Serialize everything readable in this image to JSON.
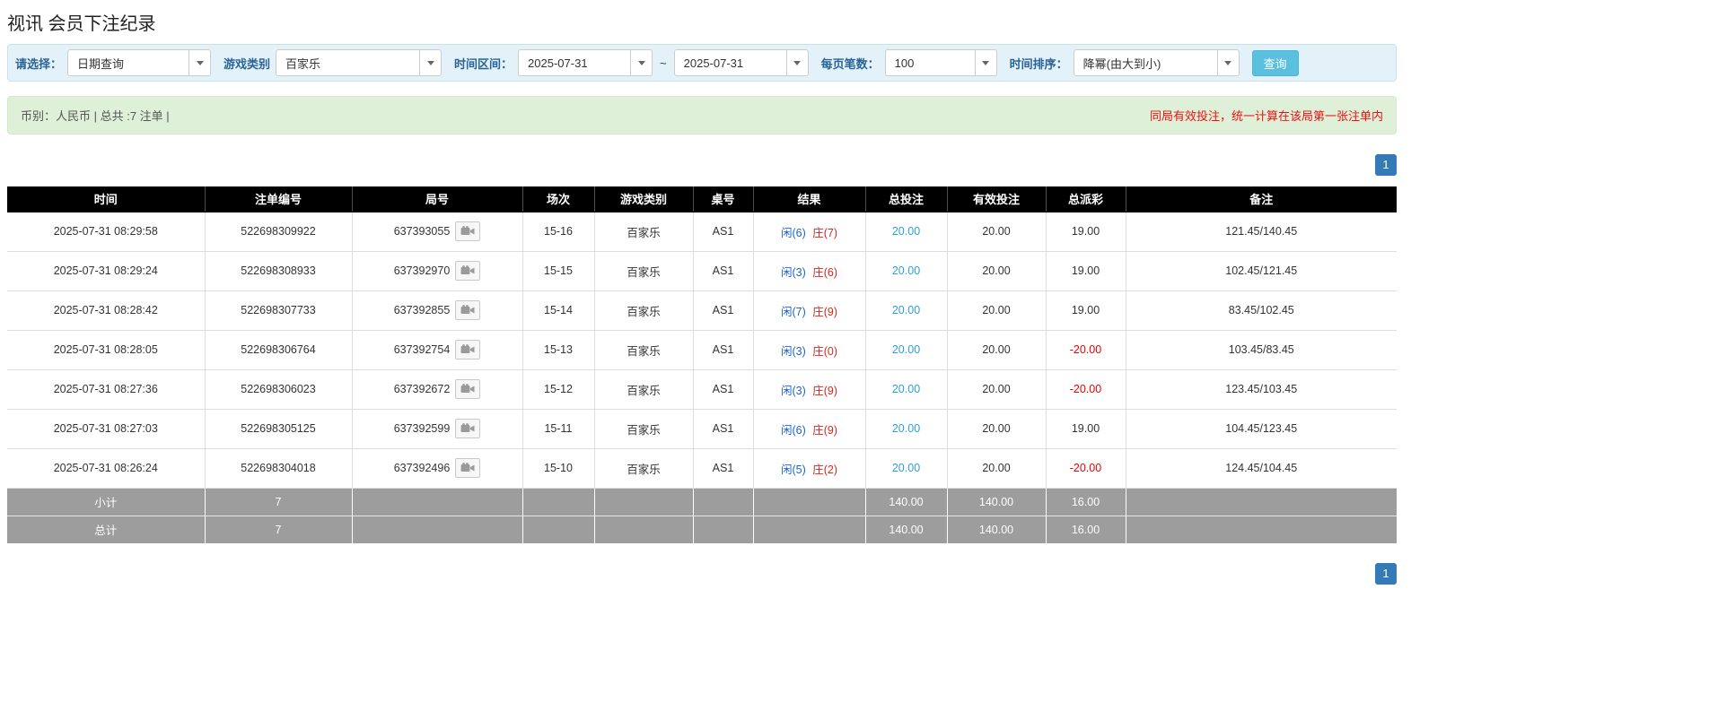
{
  "page": {
    "title": "视讯 会员下注纪录"
  },
  "filters": {
    "labels": {
      "select": "请选择：",
      "game_type": "游戏类别",
      "time_range": "时间区间：",
      "tilde": "~",
      "page_size": "每页笔数：",
      "time_sort": "时间排序："
    },
    "values": {
      "select_mode": "日期查询",
      "game_type": "百家乐",
      "date_from": "2025-07-31",
      "date_to": "2025-07-31",
      "page_size": "100",
      "time_sort": "降幂(由大到小)"
    },
    "search_label": "查询"
  },
  "summary": {
    "left": "币别：人民币 | 总共 :7 注单 |",
    "right": "同局有效投注，统一计算在该局第一张注单内"
  },
  "pagination": {
    "page": "1"
  },
  "table": {
    "headers": [
      "时间",
      "注单编号",
      "局号",
      "场次",
      "游戏类别",
      "桌号",
      "结果",
      "总投注",
      "有效投注",
      "总派彩",
      "备注"
    ],
    "rows": [
      {
        "time": "2025-07-31 08:29:58",
        "bet_id": "522698309922",
        "round_id": "637393055",
        "session": "15-16",
        "game": "百家乐",
        "table_no": "AS1",
        "result_player": "闲(6)",
        "result_banker": "庄(7)",
        "total_bet": "20.00",
        "valid_bet": "20.00",
        "payout": "19.00",
        "payout_state": "pos",
        "note": "121.45/140.45"
      },
      {
        "time": "2025-07-31 08:29:24",
        "bet_id": "522698308933",
        "round_id": "637392970",
        "session": "15-15",
        "game": "百家乐",
        "table_no": "AS1",
        "result_player": "闲(3)",
        "result_banker": "庄(6)",
        "total_bet": "20.00",
        "valid_bet": "20.00",
        "payout": "19.00",
        "payout_state": "pos",
        "note": "102.45/121.45"
      },
      {
        "time": "2025-07-31 08:28:42",
        "bet_id": "522698307733",
        "round_id": "637392855",
        "session": "15-14",
        "game": "百家乐",
        "table_no": "AS1",
        "result_player": "闲(7)",
        "result_banker": "庄(9)",
        "total_bet": "20.00",
        "valid_bet": "20.00",
        "payout": "19.00",
        "payout_state": "pos",
        "note": "83.45/102.45"
      },
      {
        "time": "2025-07-31 08:28:05",
        "bet_id": "522698306764",
        "round_id": "637392754",
        "session": "15-13",
        "game": "百家乐",
        "table_no": "AS1",
        "result_player": "闲(3)",
        "result_banker": "庄(0)",
        "total_bet": "20.00",
        "valid_bet": "20.00",
        "payout": "-20.00",
        "payout_state": "neg",
        "note": "103.45/83.45"
      },
      {
        "time": "2025-07-31 08:27:36",
        "bet_id": "522698306023",
        "round_id": "637392672",
        "session": "15-12",
        "game": "百家乐",
        "table_no": "AS1",
        "result_player": "闲(3)",
        "result_banker": "庄(9)",
        "total_bet": "20.00",
        "valid_bet": "20.00",
        "payout": "-20.00",
        "payout_state": "neg",
        "note": "123.45/103.45"
      },
      {
        "time": "2025-07-31 08:27:03",
        "bet_id": "522698305125",
        "round_id": "637392599",
        "session": "15-11",
        "game": "百家乐",
        "table_no": "AS1",
        "result_player": "闲(6)",
        "result_banker": "庄(9)",
        "total_bet": "20.00",
        "valid_bet": "20.00",
        "payout": "19.00",
        "payout_state": "pos",
        "note": "104.45/123.45"
      },
      {
        "time": "2025-07-31 08:26:24",
        "bet_id": "522698304018",
        "round_id": "637392496",
        "session": "15-10",
        "game": "百家乐",
        "table_no": "AS1",
        "result_player": "闲(5)",
        "result_banker": "庄(2)",
        "total_bet": "20.00",
        "valid_bet": "20.00",
        "payout": "-20.00",
        "payout_state": "neg",
        "note": "124.45/104.45"
      }
    ],
    "subtotal": {
      "label": "小计",
      "count": "7",
      "total_bet": "140.00",
      "valid_bet": "140.00",
      "payout": "16.00"
    },
    "total": {
      "label": "总计",
      "count": "7",
      "total_bet": "140.00",
      "valid_bet": "140.00",
      "payout": "16.00"
    }
  },
  "colors": {
    "accent_blue": "#337ab7",
    "link_blue": "#2b9fd9",
    "player_blue": "#1a62d6",
    "banker_red": "#d9261c",
    "negative_red": "#ee0000",
    "header_black": "#000000",
    "summary_green_bg": "#dff0d8",
    "filter_blue_bg": "#e3f1f9"
  }
}
